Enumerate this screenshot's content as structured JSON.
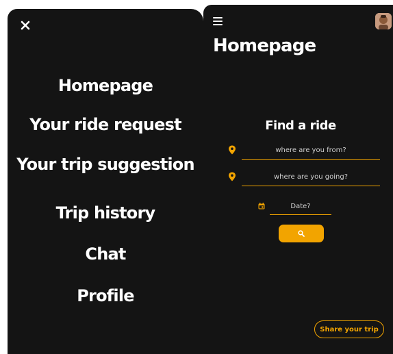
{
  "menu": {
    "close_icon": "close-icon",
    "items": [
      {
        "label": "Homepage"
      },
      {
        "label": "Your ride request"
      },
      {
        "label": "Your trip suggestion"
      },
      {
        "label": "Trip history"
      },
      {
        "label": "Chat"
      },
      {
        "label": "Profile"
      }
    ]
  },
  "app": {
    "menu_icon": "hamburger-icon",
    "avatar_icon": "user-avatar",
    "page_title": "Homepage",
    "find_ride": {
      "title": "Find a ride",
      "from_placeholder": "where are you from?",
      "to_placeholder": "where are you going?",
      "date_placeholder": "Date?",
      "search_icon": "search-icon"
    },
    "share_label": "Share your trip"
  },
  "colors": {
    "background": "#141414",
    "accent": "#f2a400",
    "text": "#ffffff"
  }
}
